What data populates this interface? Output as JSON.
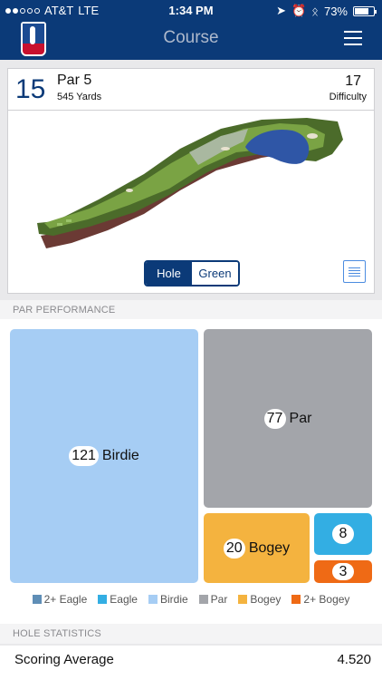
{
  "status": {
    "carrier": "AT&T",
    "network": "LTE",
    "time": "1:34 PM",
    "battery": "73%",
    "battery_level": 0.73,
    "icons": [
      "location-icon",
      "alarm-icon",
      "bluetooth-icon"
    ]
  },
  "header": {
    "title": "Course"
  },
  "hole": {
    "number": "15",
    "par": "Par 5",
    "yards": "545 Yards",
    "difficulty_value": "17",
    "difficulty_label": "Difficulty"
  },
  "view_toggle": {
    "hole": "Hole",
    "green": "Green",
    "selected": "Hole"
  },
  "par_performance": {
    "header": "PAR PERFORMANCE",
    "tiles": [
      {
        "key": "birdie",
        "count": "121",
        "label": "Birdie",
        "color": "#a6cdf4"
      },
      {
        "key": "par",
        "count": "77",
        "label": "Par",
        "color": "#a3a5aa"
      },
      {
        "key": "bogey",
        "count": "20",
        "label": "Bogey",
        "color": "#f4b33f"
      },
      {
        "key": "eagle",
        "count": "8",
        "label": "",
        "color": "#33aee3"
      },
      {
        "key": "double_bogey",
        "count": "3",
        "label": "",
        "color": "#ef6a15"
      }
    ],
    "legend": [
      {
        "label": "2+ Eagle",
        "color": "#5f8eb6"
      },
      {
        "label": "Eagle",
        "color": "#33aee3"
      },
      {
        "label": "Birdie",
        "color": "#a6cdf4"
      },
      {
        "label": "Par",
        "color": "#a3a5aa"
      },
      {
        "label": "Bogey",
        "color": "#f4b33f"
      },
      {
        "label": "2+ Bogey",
        "color": "#ef6a15"
      }
    ]
  },
  "hole_statistics": {
    "header": "HOLE STATISTICS",
    "rows": [
      {
        "label": "Scoring Average",
        "value": "4.520"
      }
    ]
  }
}
